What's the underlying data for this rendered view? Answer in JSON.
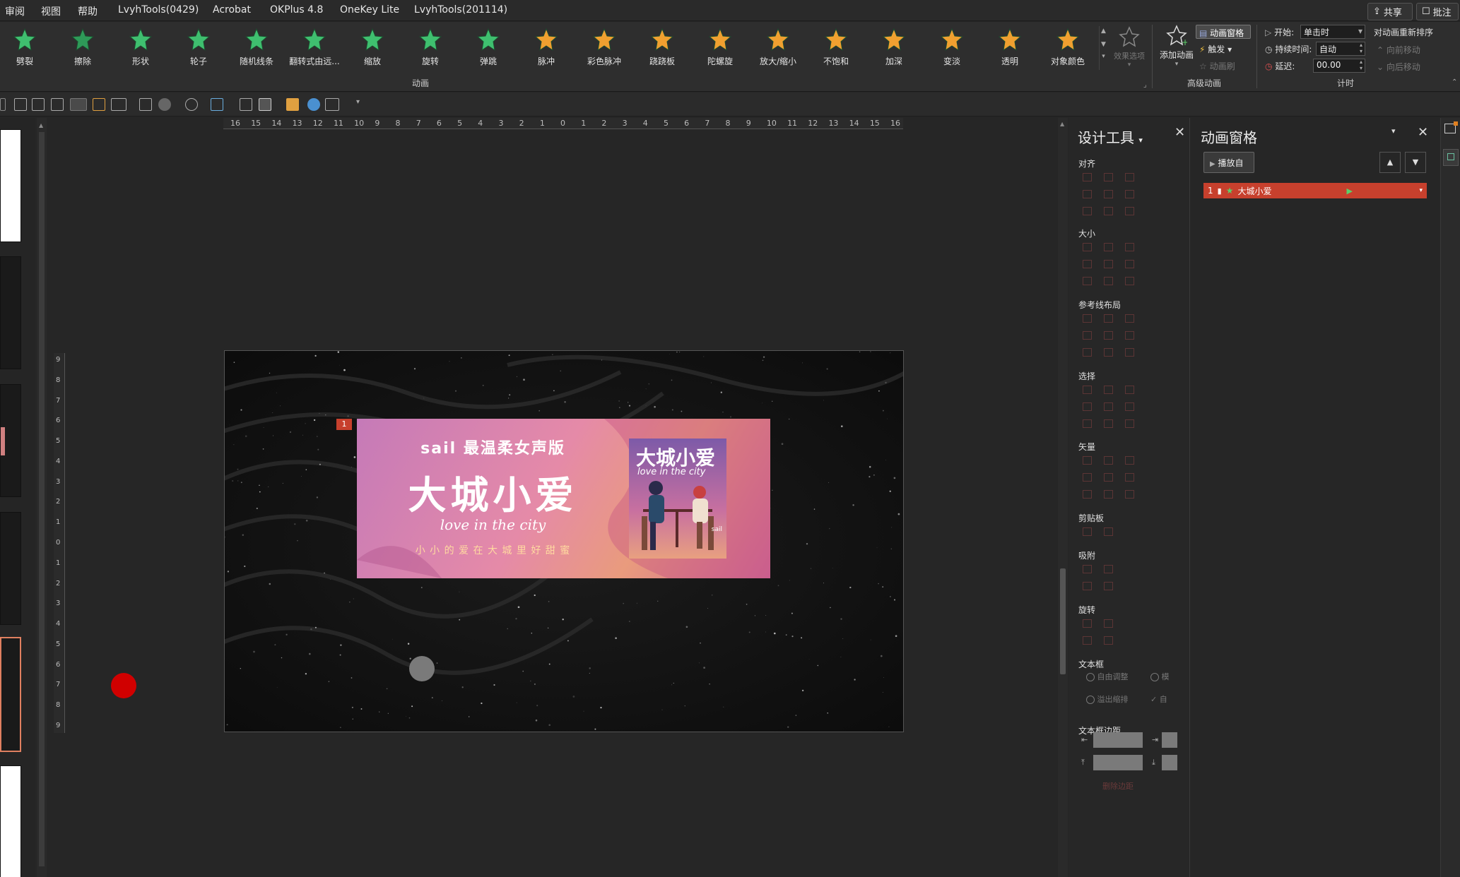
{
  "menu": {
    "items": [
      "审阅",
      "视图",
      "帮助",
      "LvyhTools(0429)",
      "Acrobat",
      "OKPlus 4.8",
      "OneKey Lite",
      "LvyhTools(201114)"
    ],
    "share_label": "共享",
    "comment_label": "批注"
  },
  "ribbon": {
    "effects": [
      {
        "label": "劈裂",
        "color": "#3fbf6f"
      },
      {
        "label": "擦除",
        "color": "#2e9a58"
      },
      {
        "label": "形状",
        "color": "#3fbf6f"
      },
      {
        "label": "轮子",
        "color": "#3fbf6f"
      },
      {
        "label": "随机线条",
        "color": "#3fbf6f"
      },
      {
        "label": "翻转式由远...",
        "color": "#3fbf6f"
      },
      {
        "label": "缩放",
        "color": "#3fbf6f"
      },
      {
        "label": "旋转",
        "color": "#3fbf6f"
      },
      {
        "label": "弹跳",
        "color": "#3fbf6f"
      },
      {
        "label": "脉冲",
        "color": "#f0a030"
      },
      {
        "label": "彩色脉冲",
        "color": "#f0a030"
      },
      {
        "label": "跷跷板",
        "color": "#f0a030"
      },
      {
        "label": "陀螺旋",
        "color": "#f0a030"
      },
      {
        "label": "放大/缩小",
        "color": "#f0a030"
      },
      {
        "label": "不饱和",
        "color": "#f0a030"
      },
      {
        "label": "加深",
        "color": "#f0a030"
      },
      {
        "label": "变淡",
        "color": "#f0a030"
      },
      {
        "label": "透明",
        "color": "#f0a030"
      },
      {
        "label": "对象颜色",
        "color": "#f0a030"
      }
    ],
    "effect_options_label": "效果选项",
    "animation_group_label": "动画",
    "add_animation_label": "添加动画",
    "animation_pane_btn": "动画窗格",
    "trigger_label": "触发",
    "anim_painter_label": "动画刷",
    "advanced_group_label": "高级动画",
    "start_label": "开始:",
    "start_value": "单击时",
    "duration_label": "持续时间:",
    "duration_value": "自动",
    "delay_label": "延迟:",
    "delay_value": "00.00",
    "timing_group_label": "计时",
    "reorder_label": "对动画重新排序",
    "move_earlier": "向前移动",
    "move_later": "向后移动"
  },
  "ruler": {
    "h_ticks": [
      "16",
      "15",
      "14",
      "13",
      "12",
      "11",
      "10",
      "9",
      "8",
      "7",
      "6",
      "5",
      "4",
      "3",
      "2",
      "1",
      "0",
      "1",
      "2",
      "3",
      "4",
      "5",
      "6",
      "7",
      "8",
      "9",
      "10",
      "11",
      "12",
      "13",
      "14",
      "15",
      "16"
    ],
    "v_ticks": [
      "9",
      "8",
      "7",
      "6",
      "5",
      "4",
      "3",
      "2",
      "1",
      "0",
      "1",
      "2",
      "3",
      "4",
      "5",
      "6",
      "7",
      "8",
      "9"
    ]
  },
  "slide": {
    "anim_badge": "1",
    "banner": {
      "line1": "sail 最温柔女声版",
      "title": "大城小爱",
      "script": "love in the city",
      "tagline": "小 小 的 爱   在 大 城 里 好 甜 蜜",
      "poster_title": "大城小爱",
      "poster_script": "love in the city",
      "poster_brand": "sail"
    }
  },
  "design_tools": {
    "title": "设计工具",
    "sections": [
      "对齐",
      "大小",
      "参考线布局",
      "选择",
      "矢量",
      "剪贴板",
      "吸附",
      "旋转",
      "文本框",
      "文本框边距"
    ],
    "radio_auto": "自由调整",
    "radio_overflow": "溢出缩排",
    "radio_other": "模",
    "check_other": "自",
    "bottom_link": "删除边距"
  },
  "animation_pane": {
    "title": "动画窗格",
    "play_from": "播放自",
    "item": {
      "index": "1",
      "name": "大城小爱"
    }
  },
  "colors": {
    "accent_red": "#c7402d",
    "green_star": "#3fbf6f",
    "orange_star": "#f0a030"
  }
}
